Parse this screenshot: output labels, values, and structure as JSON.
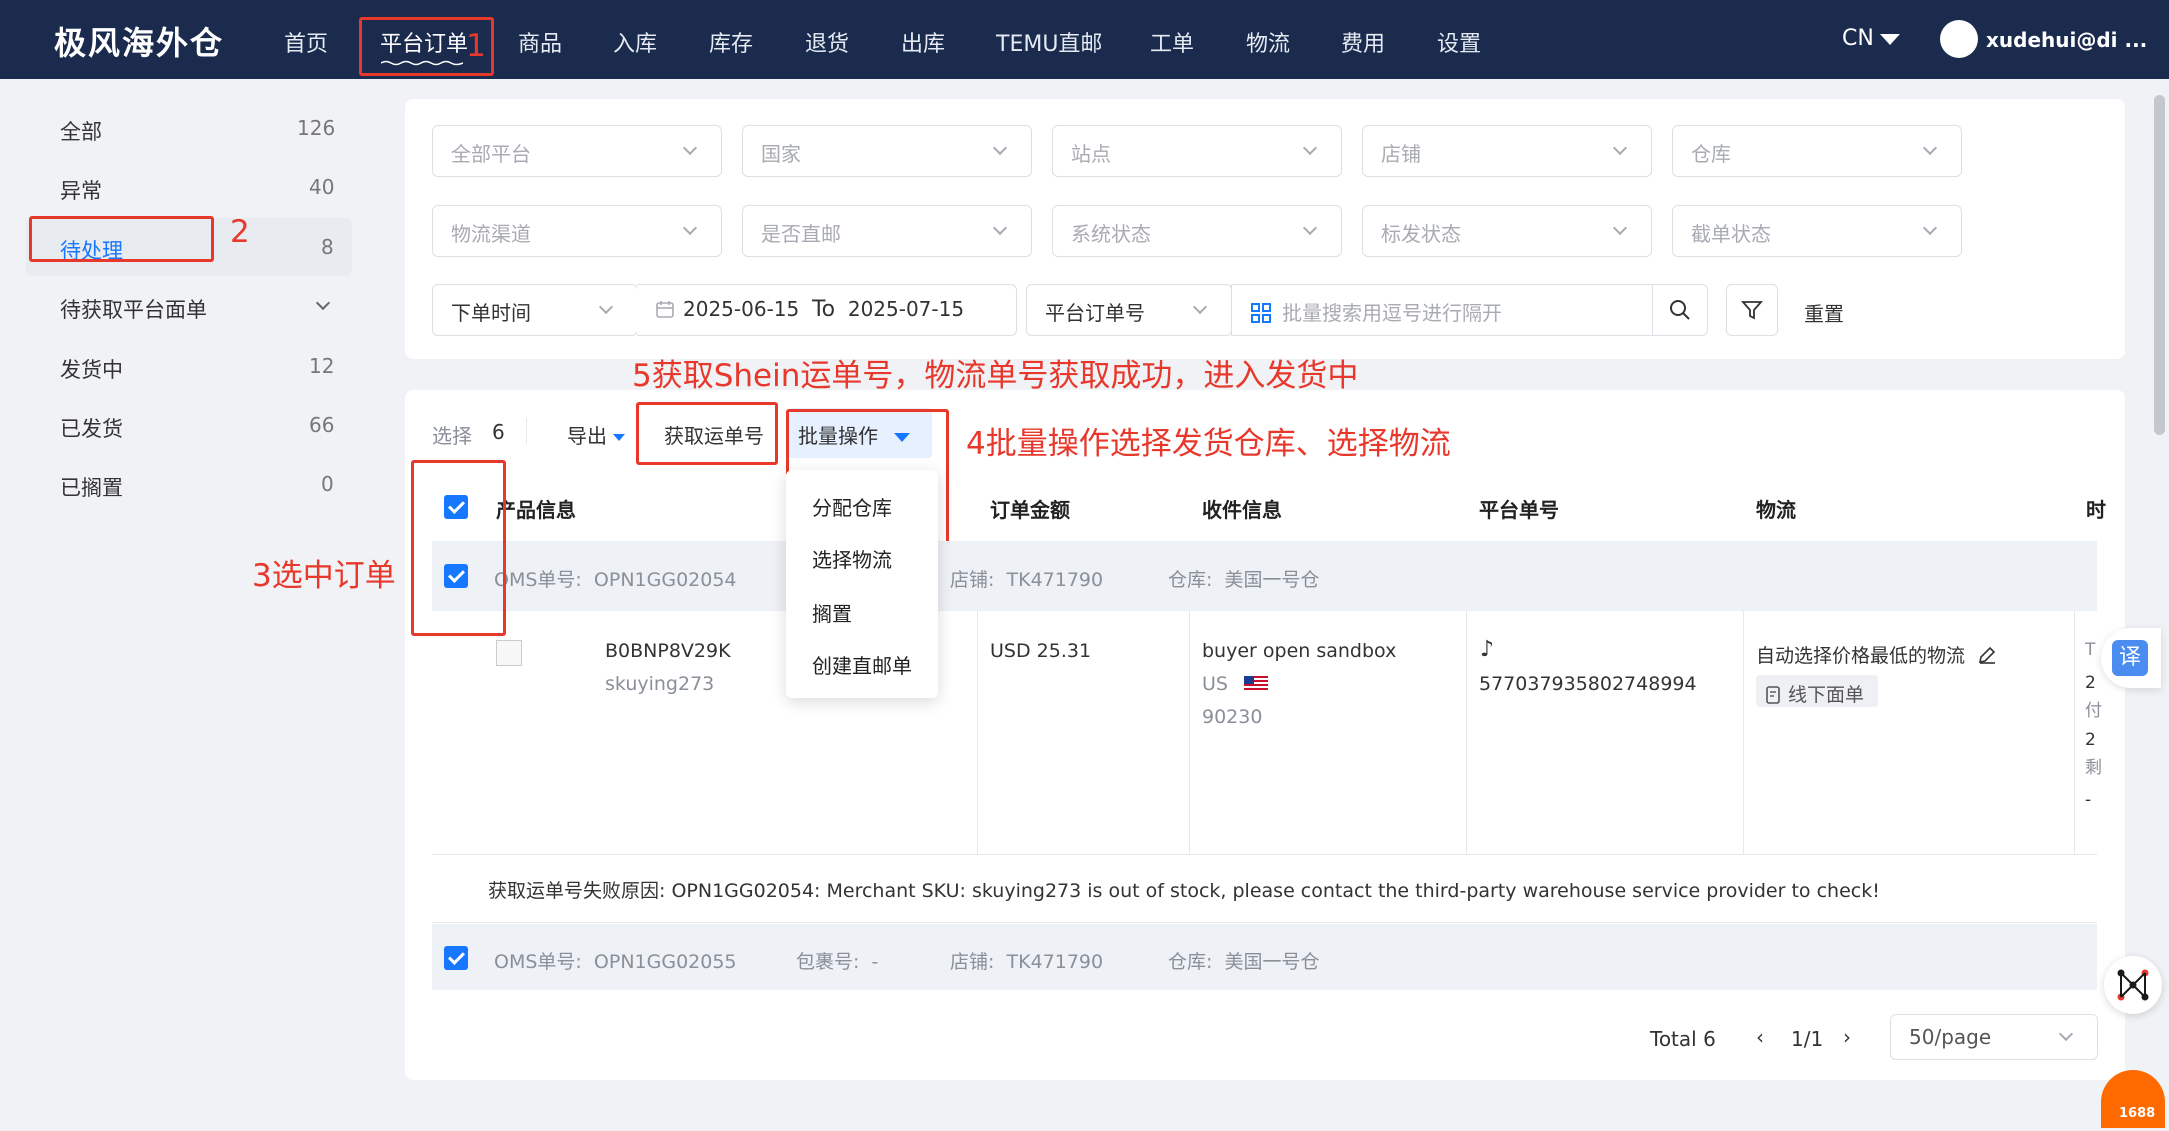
{
  "app": {
    "brand": "极风海外仓"
  },
  "nav": {
    "items": [
      "首页",
      "平台订单",
      "商品",
      "入库",
      "库存",
      "退货",
      "出库",
      "TEMU直邮",
      "工单",
      "物流",
      "费用",
      "设置"
    ],
    "lang": "CN",
    "user": "xudehui@di ..."
  },
  "sidebar": {
    "items": [
      {
        "label": "全部",
        "count": "126"
      },
      {
        "label": "异常",
        "count": "40"
      },
      {
        "label": "待处理",
        "count": "8"
      },
      {
        "label": "待获取平台面单",
        "count": ""
      },
      {
        "label": "发货中",
        "count": "12"
      },
      {
        "label": "已发货",
        "count": "66"
      },
      {
        "label": "已搁置",
        "count": "0"
      }
    ]
  },
  "filters": {
    "row1": [
      "全部平台",
      "国家",
      "站点",
      "店铺",
      "仓库"
    ],
    "row2": [
      "物流渠道",
      "是否直邮",
      "系统状态",
      "标发状态",
      "截单状态"
    ],
    "time_type": "下单时间",
    "date_start": "2025-06-15",
    "date_to": "To",
    "date_end": "2025-07-15",
    "search_type": "平台订单号",
    "search_placeholder": "批量搜索用逗号进行隔开",
    "reset": "重置"
  },
  "toolbar": {
    "select_label": "选择",
    "select_count": "6",
    "export": "导出",
    "get_tracking": "获取运单号",
    "batch": "批量操作"
  },
  "dropdown": {
    "items": [
      "分配仓库",
      "选择物流",
      "搁置",
      "创建直邮单"
    ]
  },
  "table": {
    "headers": [
      "产品信息",
      "订单金额",
      "收件信息",
      "平台单号",
      "物流",
      "时"
    ],
    "order1": {
      "oms_label": "OMS单号:",
      "oms": "OPN1GG02054",
      "shop_label": "店铺:",
      "shop": "TK471790",
      "wh_label": "仓库:",
      "wh": "美国一号仓",
      "sku": "B0BNP8V29K",
      "seller_sku": "skuying273",
      "amount": "USD 25.31",
      "buyer": "buyer open sandbox",
      "country": "US",
      "zip": "90230",
      "platform_no": "577037935802748994",
      "logistics": "自动选择价格最低的物流",
      "label_tag": "线下面单",
      "time_col": [
        "T",
        "2",
        "付",
        "2",
        "剩",
        "-"
      ],
      "error": "获取运单号失败原因: OPN1GG02054: Merchant SKU: skuying273 is out of stock, please contact the third-party warehouse service provider to check!"
    },
    "order2": {
      "oms_label": "OMS单号:",
      "oms": "OPN1GG02055",
      "pkg_label": "包裹号:",
      "pkg": "-",
      "shop_label": "店铺:",
      "shop": "TK471790",
      "wh_label": "仓库:",
      "wh": "美国一号仓"
    }
  },
  "pager": {
    "total": "Total 6",
    "page": "1/1",
    "size": "50/page"
  },
  "annotations": {
    "a1": "1",
    "a2": "2",
    "a3": "3选中订单",
    "a4": "4批量操作选择发货仓库、选择物流",
    "a5": "5获取Shein运单号，物流单号获取成功，进入发货中"
  },
  "float": {
    "translate": "译",
    "ali": "1688"
  },
  "colors": {
    "nav_bg": "#1a2b4d",
    "primary": "#1677ff",
    "annotation": "#e8372b"
  }
}
